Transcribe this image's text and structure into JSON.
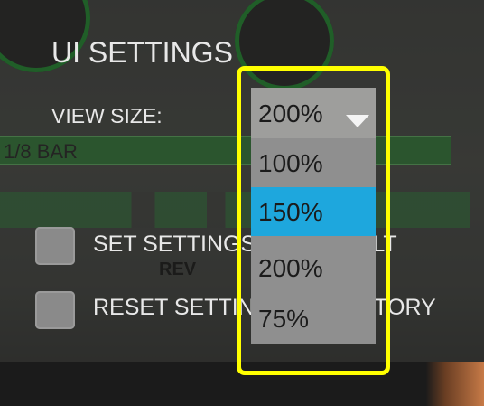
{
  "background": {
    "rate_label": "1/8 BAR",
    "rev_label": "REV"
  },
  "settings": {
    "title": "UI SETTINGS",
    "view_size_label": "VIEW SIZE:",
    "set_default_label": "SET SETTINGS AS DEFAULT",
    "reset_factory_label": "RESET SETTINGS TO FACTORY"
  },
  "view_size_dropdown": {
    "selected": "200%",
    "options": [
      "100%",
      "150%",
      "200%",
      "75%"
    ],
    "highlighted_option": "150%"
  },
  "colors": {
    "highlight_outline": "#ffff00",
    "option_highlight": "#1ea7dd",
    "accent_green": "#2b8a3b"
  }
}
